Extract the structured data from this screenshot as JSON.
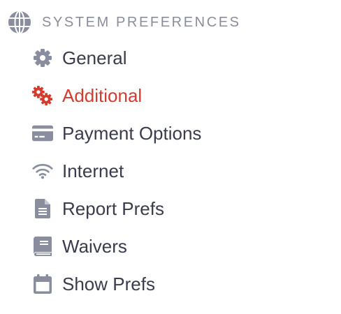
{
  "section": {
    "title": "SYSTEM PREFERENCES",
    "icon": "globe-icon"
  },
  "colors": {
    "header_text": "#8a8d9d",
    "icon": "#8a8d9d",
    "label": "#3a3c4e",
    "active": "#d63b2f"
  },
  "menu": {
    "items": [
      {
        "label": "General",
        "icon": "gear-icon",
        "active": false
      },
      {
        "label": "Additional",
        "icon": "gears-icon",
        "active": true
      },
      {
        "label": "Payment Options",
        "icon": "credit-card-icon",
        "active": false
      },
      {
        "label": "Internet",
        "icon": "wifi-icon",
        "active": false
      },
      {
        "label": "Report Prefs",
        "icon": "document-icon",
        "active": false
      },
      {
        "label": "Waivers",
        "icon": "book-icon",
        "active": false
      },
      {
        "label": "Show Prefs",
        "icon": "calendar-icon",
        "active": false
      }
    ]
  }
}
